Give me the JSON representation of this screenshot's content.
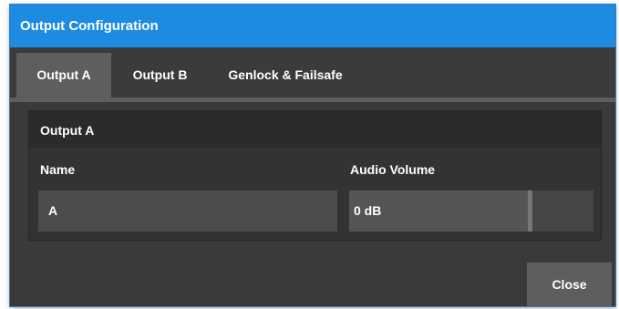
{
  "window": {
    "title": "Output Configuration"
  },
  "tabs": [
    {
      "label": "Output A",
      "active": true
    },
    {
      "label": "Output B",
      "active": false
    },
    {
      "label": "Genlock & Failsafe",
      "active": false
    }
  ],
  "group": {
    "title": "Output A",
    "name_label": "Name",
    "name_value": "A",
    "audio_label": "Audio Volume",
    "audio_value": "0 dB",
    "audio_level_fraction": 0.75
  },
  "footer": {
    "close_label": "Close"
  },
  "colors": {
    "title_bar": "#1e8be2",
    "dialog_bg": "#3a3a3a",
    "active_tab": "#5e5e5e"
  }
}
